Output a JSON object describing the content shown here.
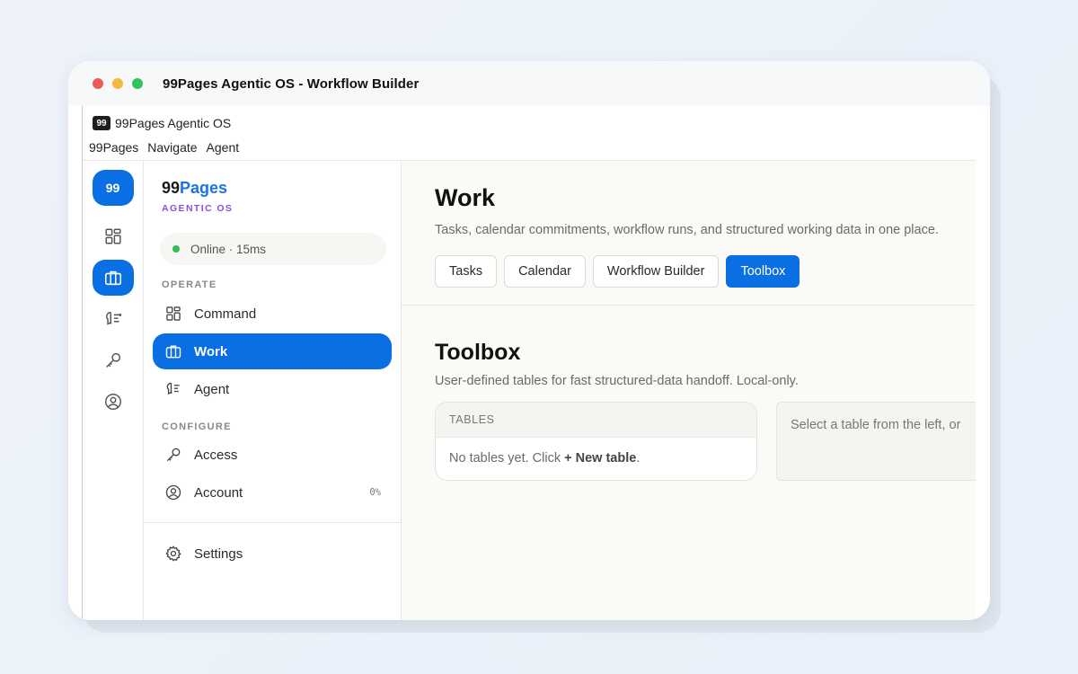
{
  "window": {
    "title": "99Pages Agentic OS - Workflow Builder"
  },
  "app": {
    "logo": "99",
    "name": "99Pages Agentic OS",
    "menu": [
      "99Pages",
      "Navigate",
      "Agent"
    ]
  },
  "rail": {
    "badge": "99",
    "icons": [
      "grid-icon",
      "briefcase-icon",
      "agent-icon",
      "key-icon",
      "user-circle-icon"
    ],
    "active": "briefcase-icon"
  },
  "sidebar": {
    "brand_prefix": "99",
    "brand_accent": "Pages",
    "brand_sub": "AGENTIC OS",
    "status": "Online · 15ms",
    "sections": {
      "operate": "OPERATE",
      "configure": "CONFIGURE"
    },
    "items": {
      "command": "Command",
      "work": "Work",
      "agent": "Agent",
      "access": "Access",
      "account": "Account",
      "account_count": "0%",
      "settings": "Settings"
    },
    "active": "Work"
  },
  "main": {
    "title": "Work",
    "subtitle": "Tasks, calendar commitments, workflow runs, and structured working data in one place.",
    "tabs": [
      "Tasks",
      "Calendar",
      "Workflow Builder",
      "Toolbox"
    ],
    "active_tab": "Toolbox",
    "toolbox": {
      "title": "Toolbox",
      "subtitle": "User-defined tables for fast structured-data handoff. Local-only.",
      "tables_header": "TABLES",
      "empty_prefix": "No tables yet. Click ",
      "empty_action": "+ New table",
      "empty_suffix": ".",
      "detail_placeholder": "Select a table from the left, or"
    }
  },
  "colors": {
    "accent": "#0a6fe3",
    "brand_accent": "#1a74e8",
    "brand_sub": "#8a4fe0",
    "online": "#2fbf57"
  }
}
